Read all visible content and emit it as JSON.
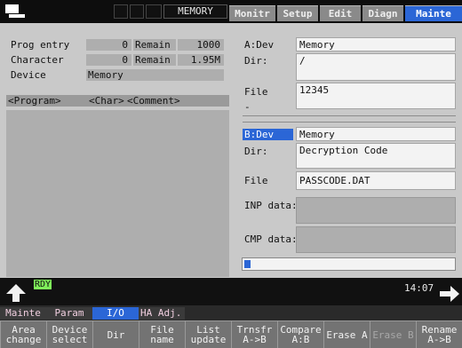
{
  "topbar": {
    "mode": "MEMORY",
    "tabs": [
      {
        "label": "Monitr",
        "active": false
      },
      {
        "label": "Setup",
        "active": false
      },
      {
        "label": "Edit",
        "active": false
      },
      {
        "label": "Diagn",
        "active": false
      },
      {
        "label": "Mainte",
        "active": true
      }
    ]
  },
  "left": {
    "prog_entry": {
      "label": "Prog entry",
      "value": "0",
      "remain_label": "Remain",
      "remain": "1000"
    },
    "character": {
      "label": "Character",
      "value": "0",
      "remain_label": "Remain",
      "remain": "1.95M"
    },
    "device": {
      "label": "Device",
      "value": "Memory"
    },
    "list_header": {
      "program": "<Program>",
      "char": "<Char>",
      "comment": "<Comment>"
    }
  },
  "device_a": {
    "dev_label": "A:Dev",
    "dev_value": "Memory",
    "dir_label": "Dir:",
    "dir_value": "/",
    "file_label": "File",
    "file_value": "12345",
    "extra_label": "-"
  },
  "device_b": {
    "dev_label": "B:Dev",
    "dev_value": "Memory",
    "dir_label": "Dir:",
    "dir_value": "Decryption Code",
    "file_label": "File",
    "file_value": "PASSCODE.DAT",
    "inp_label": "INP data:",
    "cmp_label": "CMP data:"
  },
  "progress": {
    "fraction": 0.03
  },
  "status": {
    "ready": "RDY",
    "time": "14:07"
  },
  "menu_tabs": [
    {
      "label": "Mainte",
      "state": "normal"
    },
    {
      "label": "Param",
      "state": "normal"
    },
    {
      "label": "I/O",
      "state": "selected"
    },
    {
      "label": "HA Adj.",
      "state": "normal"
    }
  ],
  "softkeys": [
    {
      "label": "Area\nchange",
      "enabled": true
    },
    {
      "label": "Device\nselect",
      "enabled": true
    },
    {
      "label": "Dir",
      "enabled": true
    },
    {
      "label": "File\nname",
      "enabled": true
    },
    {
      "label": "List\nupdate",
      "enabled": true
    },
    {
      "label": "Trnsfr\nA->B",
      "enabled": true
    },
    {
      "label": "Compare\nA:B",
      "enabled": true
    },
    {
      "label": "Erase A",
      "enabled": true
    },
    {
      "label": "Erase B",
      "enabled": false
    },
    {
      "label": "Rename\nA->B",
      "enabled": true
    }
  ],
  "colors": {
    "accent": "#2b66d6",
    "ready": "#7ff05a",
    "background": "#c9c9c9"
  },
  "icons": {
    "logo": "screen-icon",
    "up": "up-arrow-icon",
    "next": "right-arrow-icon"
  }
}
